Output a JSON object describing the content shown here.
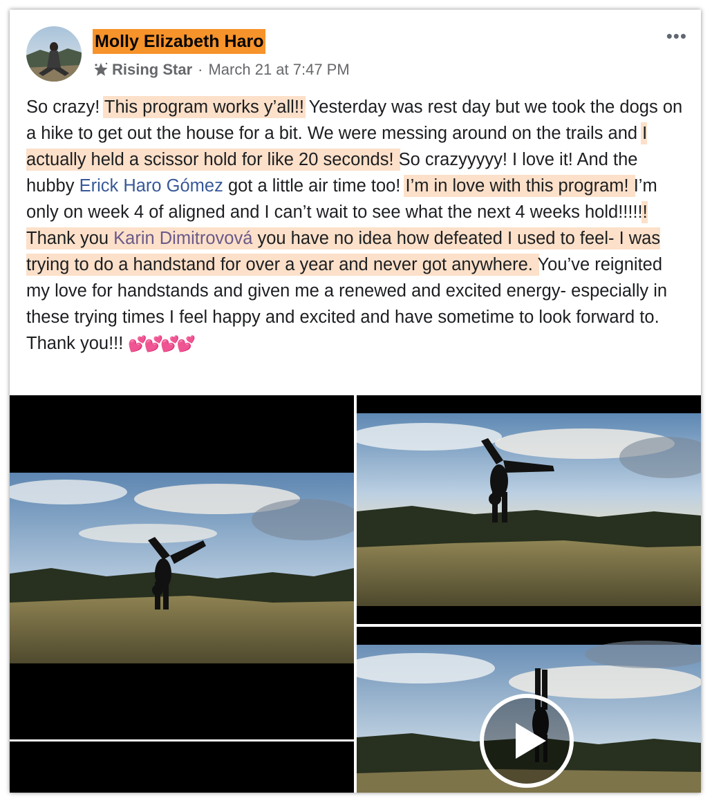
{
  "post": {
    "author": "Molly Elizabeth Haro",
    "badge": "Rising Star",
    "badge_icon": "star-badge-icon",
    "separator": "·",
    "timestamp": "March 21 at 7:47 PM",
    "menu_label": "•••",
    "text": {
      "p1": "So crazy! ",
      "h1": "This program works y’all!!",
      "p2": " Yesterday was rest day but we took the dogs on a hike to get out the house for a bit. We were messing around on the trails and ",
      "h2": "I actually held a scissor hold for like 20 seconds! ",
      "p3": "So crazyyyyy! I love it! And the hubby ",
      "mention1": "Erick Haro Gómez",
      "p4": " got a little air time too! ",
      "h3": "I’m in love with this program! ",
      "p5": "I’m only on week 4 of aligned and I can’t wait to see what the next 4 weeks hold!!!!!",
      "h4a": "! Thank you ",
      "mention2": "Karin Dimitrovová",
      "h4b": " you have no idea how defeated I used to feel- I was trying to do a handstand for over a year and never got anywhere. ",
      "p6": "You’ve reignited my love for handstands and given me a renewed and excited energy- especially in these trying times I feel happy and excited and have sometime to look forward to. Thank you!!! ",
      "hearts": "💕💕💕💕"
    }
  },
  "colors": {
    "name_highlight": "#f7932b",
    "text_highlight": "#f7a564",
    "link": "#385898",
    "muted": "#65676b"
  },
  "media": [
    {
      "kind": "photo",
      "subject": "split handstand at sunset"
    },
    {
      "kind": "photo",
      "subject": "split handstand at sunset"
    },
    {
      "kind": "video",
      "subject": "straight handstand",
      "icon": "play-icon"
    }
  ]
}
